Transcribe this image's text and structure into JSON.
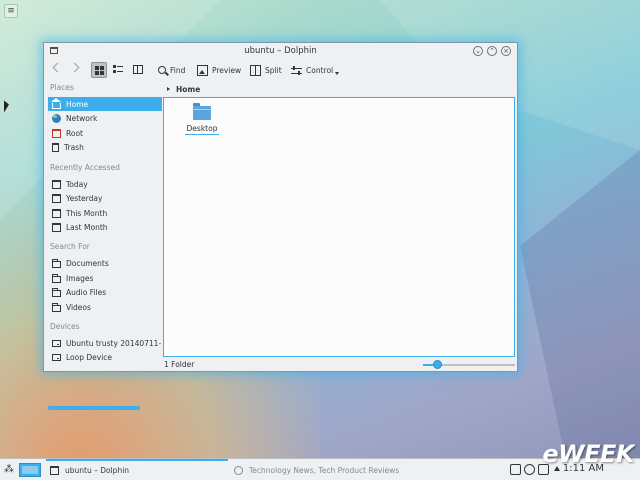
{
  "window": {
    "title": "ubuntu – Dolphin"
  },
  "toolbar": {
    "find_label": "Find",
    "preview_label": "Preview",
    "split_label": "Split",
    "control_label": "Control"
  },
  "sidebar": {
    "sections": [
      {
        "heading": "Places",
        "items": [
          {
            "label": "Home",
            "icon": "home-icon",
            "selected": true
          },
          {
            "label": "Network",
            "icon": "network-icon"
          },
          {
            "label": "Root",
            "icon": "root-folder-icon"
          },
          {
            "label": "Trash",
            "icon": "trash-icon"
          }
        ]
      },
      {
        "heading": "Recently Accessed",
        "items": [
          {
            "label": "Today",
            "icon": "calendar-icon"
          },
          {
            "label": "Yesterday",
            "icon": "calendar-icon"
          },
          {
            "label": "This Month",
            "icon": "calendar-icon"
          },
          {
            "label": "Last Month",
            "icon": "calendar-icon"
          }
        ]
      },
      {
        "heading": "Search For",
        "items": [
          {
            "label": "Documents",
            "icon": "folder-icon"
          },
          {
            "label": "Images",
            "icon": "folder-icon"
          },
          {
            "label": "Audio Files",
            "icon": "folder-icon"
          },
          {
            "label": "Videos",
            "icon": "folder-icon"
          }
        ]
      },
      {
        "heading": "Devices",
        "items": [
          {
            "label": "Ubuntu trusty 20140711-",
            "icon": "drive-icon"
          },
          {
            "label": "Loop Device",
            "icon": "drive-icon"
          }
        ]
      }
    ]
  },
  "breadcrumb": {
    "current": "Home"
  },
  "files": [
    {
      "name": "Desktop",
      "icon": "folder-icon"
    }
  ],
  "statusbar": {
    "text": "1 Folder",
    "zoom_level": 0.15
  },
  "taskbar": {
    "tasks": [
      {
        "label": "ubuntu – Dolphin",
        "active": true
      },
      {
        "label": "Technology News, Tech Product Reviews,",
        "active": false
      }
    ],
    "clock": "1:11 AM"
  },
  "watermark": "eWEEK",
  "colors": {
    "accent": "#3daee9",
    "window_bg": "#eff0f1",
    "view_bg": "#fcfcfc"
  }
}
